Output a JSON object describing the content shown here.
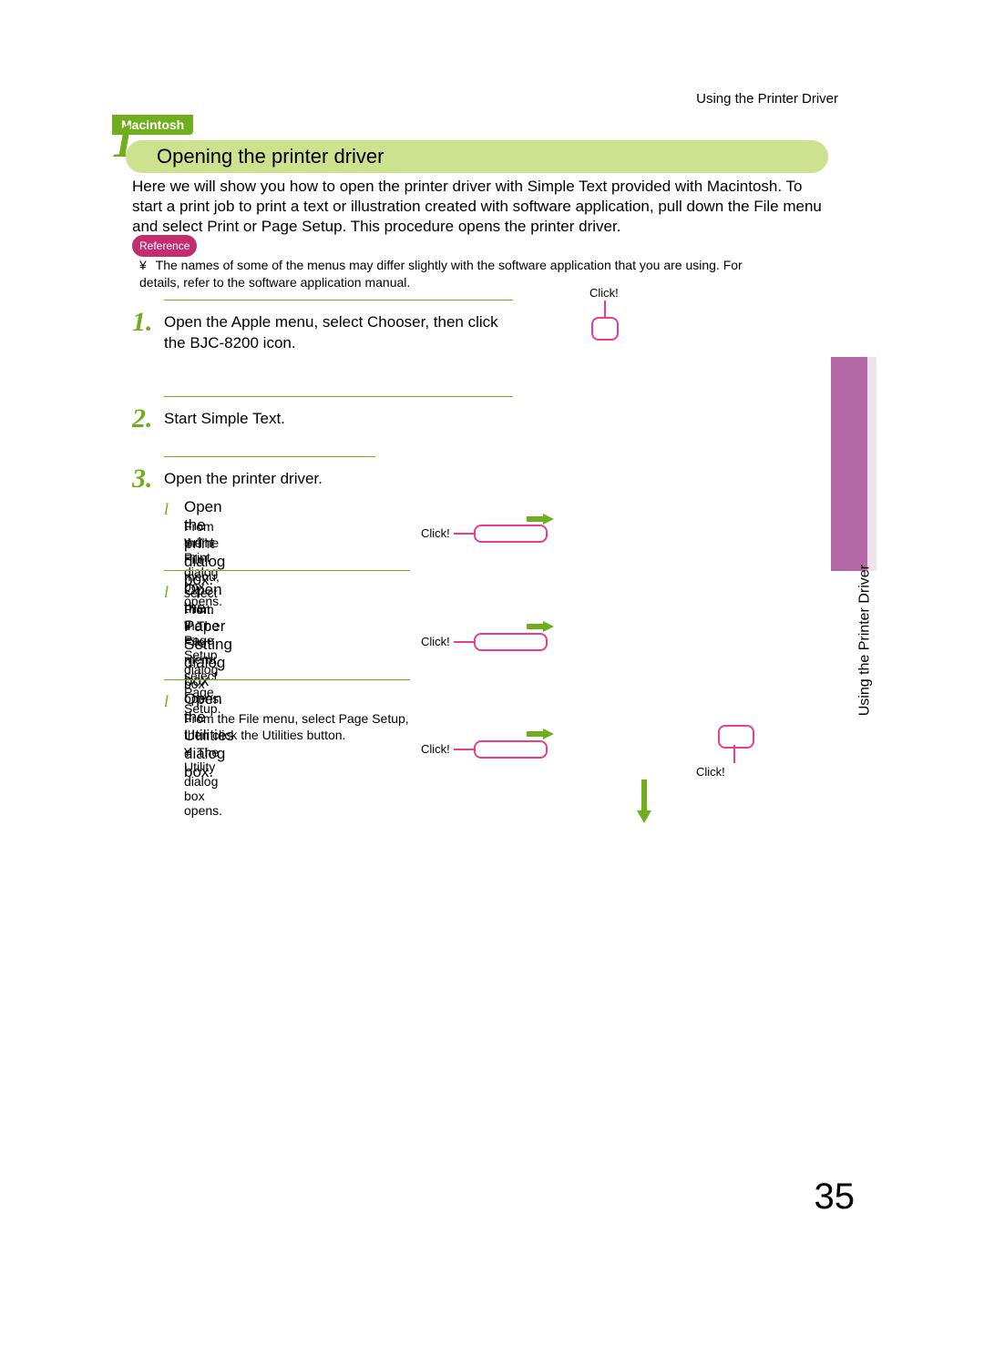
{
  "header": {
    "running": "Using the Printer Driver"
  },
  "os_tag": "Macintosh",
  "section": {
    "number": "1",
    "title": "Opening the printer driver"
  },
  "intro": "Here we will show you how to open the printer driver with Simple Text provided with Macintosh. To start a print job to print a text or illustration created with software application, pull down the File menu and select Print or Page Setup. This procedure opens the printer driver.",
  "reference": {
    "label": "Reference",
    "bullet": "¥",
    "text": "The names of some of the menus may differ slightly with the software application that you are using. For details, refer to the software application manual."
  },
  "steps": {
    "s1": {
      "num": "1.",
      "text": "Open the Apple menu, select Chooser, then click the BJC-8200 icon."
    },
    "s2": {
      "num": "2.",
      "text": "Start Simple Text."
    },
    "s3": {
      "num": "3.",
      "text": "Open the printer driver."
    }
  },
  "subs": {
    "a": {
      "bullet": "l",
      "title": "Open the print dialog box.",
      "desc": "From the File menu, select Print.",
      "note_bullet": "¥",
      "note": "The Print dialog box opens."
    },
    "b": {
      "bullet": "l",
      "title": "Open the Paper Setting dialog box",
      "desc": "From the File menu, select Page Setup.",
      "note_bullet": "¥",
      "note": "The Page Setup dialog box opens."
    },
    "c": {
      "bullet": "l",
      "title": "Open the Utilities dialog box.",
      "desc": "From the File menu, select Page Setup, then click the Utilities button.",
      "note_bullet": "¥",
      "note": "The Utility dialog box opens."
    }
  },
  "click_label": "Click!",
  "side_tab": "Using the Printer Driver",
  "page_number": "35"
}
